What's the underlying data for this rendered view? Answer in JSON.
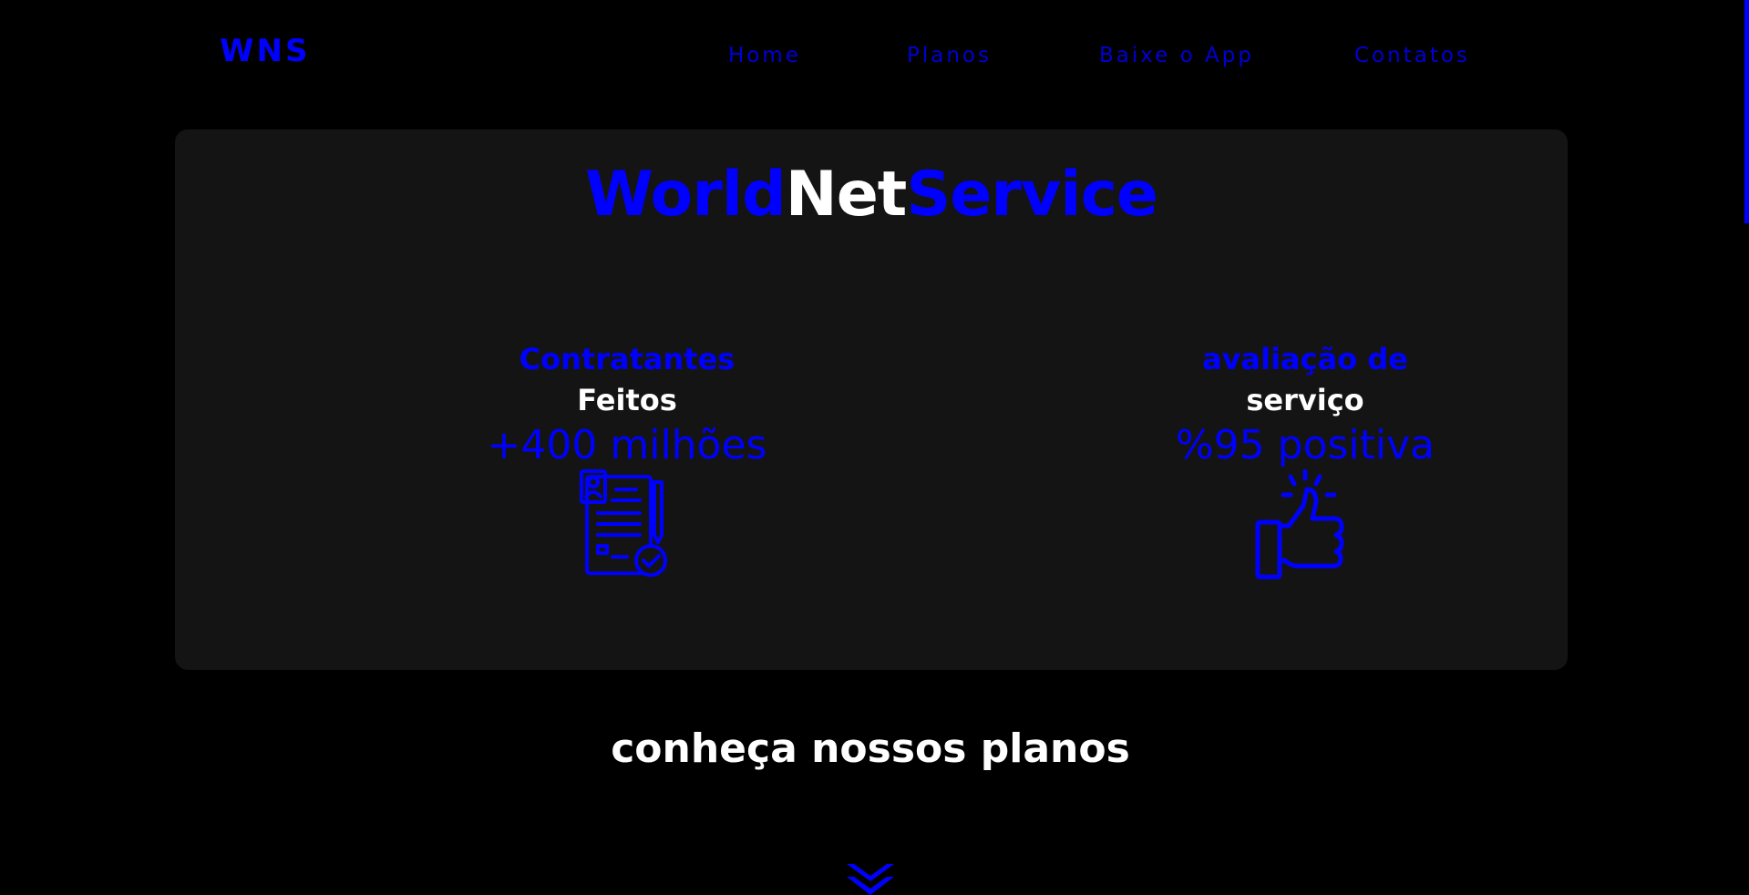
{
  "header": {
    "logo": "WNS",
    "nav": [
      {
        "label": "Home"
      },
      {
        "label": "Planos"
      },
      {
        "label": "Baixe o App"
      },
      {
        "label": "Contatos"
      }
    ]
  },
  "hero": {
    "title_part1": "World",
    "title_part2": "Net",
    "title_part3": "Service",
    "stats": [
      {
        "line1": "Contratantes",
        "line2": "Feitos",
        "value": "+400 milhões",
        "icon": "contract-document-icon"
      },
      {
        "line1": "avaliação de",
        "line2": "serviço",
        "value": "%95 positiva",
        "icon": "thumbs-up-icon"
      }
    ]
  },
  "plans": {
    "heading": "conheça nossos planos",
    "scroll_icon": "double-chevron-down-icon"
  },
  "colors": {
    "background": "#000000",
    "card": "#141414",
    "accent": "#0000ff",
    "text": "#ffffff"
  }
}
